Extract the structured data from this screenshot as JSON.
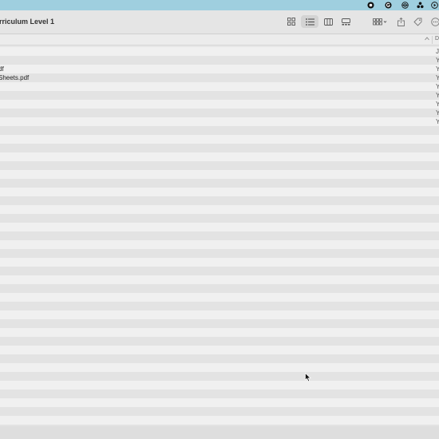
{
  "window": {
    "title": "rriculum Level 1"
  },
  "menubar": {
    "icons": [
      "record-icon",
      "grammarly-icon",
      "network-icon",
      "dots-cluster-icon",
      "play-circle-icon"
    ],
    "background": "#9fcfdf"
  },
  "toolbar": {
    "view_buttons": [
      "icon-view-icon",
      "list-view-icon",
      "column-view-icon",
      "gallery-view-icon"
    ],
    "active_view": "list-view-icon",
    "actions": [
      "group-by-icon",
      "share-icon",
      "tag-icon",
      "more-icon"
    ]
  },
  "header": {
    "date_column_label": "D"
  },
  "files": [
    {
      "name": "",
      "date": "J"
    },
    {
      "name": "",
      "date": "Y"
    },
    {
      "name": "df",
      "date": "Y"
    },
    {
      "name": "Sheets.pdf",
      "date": "Y"
    },
    {
      "name": "",
      "date": "Y"
    },
    {
      "name": "",
      "date": "Y"
    },
    {
      "name": "",
      "date": "Y"
    },
    {
      "name": "",
      "date": "Y"
    },
    {
      "name": "",
      "date": "Y"
    }
  ],
  "colors": {
    "row_even": "#f0f0f0",
    "row_odd": "#e3e3e3",
    "accent": "#9fcfdf"
  }
}
